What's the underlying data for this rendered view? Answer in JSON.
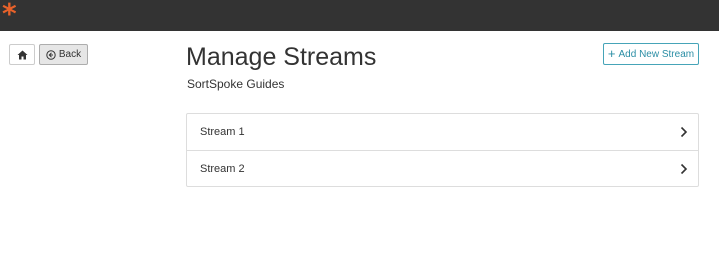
{
  "header": {
    "logo_glyph": "*",
    "brand_color": "#e8622a",
    "bar_color": "#333333"
  },
  "nav": {
    "home_icon": "home-icon",
    "back_label": "Back",
    "back_icon": "circle-arrow-left-icon"
  },
  "page": {
    "title": "Manage Streams",
    "subtitle": "SortSpoke Guides"
  },
  "actions": {
    "add_label": "Add New Stream",
    "add_icon": "plus-icon",
    "accent_color": "#2b8ea5"
  },
  "streams": [
    {
      "label": "Stream 1"
    },
    {
      "label": "Stream 2"
    }
  ]
}
